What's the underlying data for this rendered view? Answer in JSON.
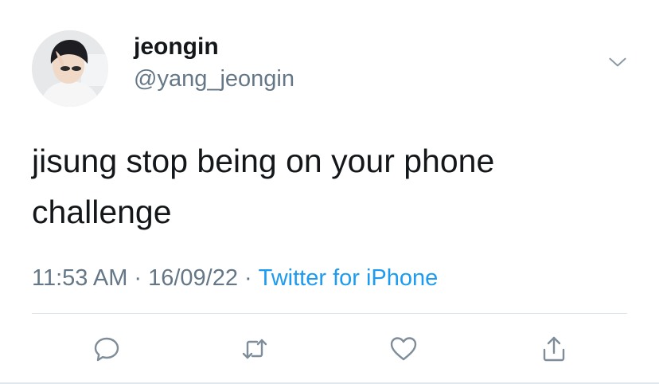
{
  "user": {
    "display_name": "jeongin",
    "handle": "@yang_jeongin"
  },
  "tweet": {
    "text": "jisung stop being on your phone challenge",
    "time": "11:53 AM",
    "separator": "·",
    "date": "16/09/22",
    "source": "Twitter for iPhone"
  },
  "icons": {
    "more": "chevron-down-icon",
    "reply": "reply-icon",
    "retweet": "retweet-icon",
    "like": "heart-icon",
    "share": "share-icon"
  },
  "colors": {
    "text": "#14171a",
    "secondary": "#657786",
    "link": "#1d9bf0",
    "divider": "#e1e8ed"
  }
}
